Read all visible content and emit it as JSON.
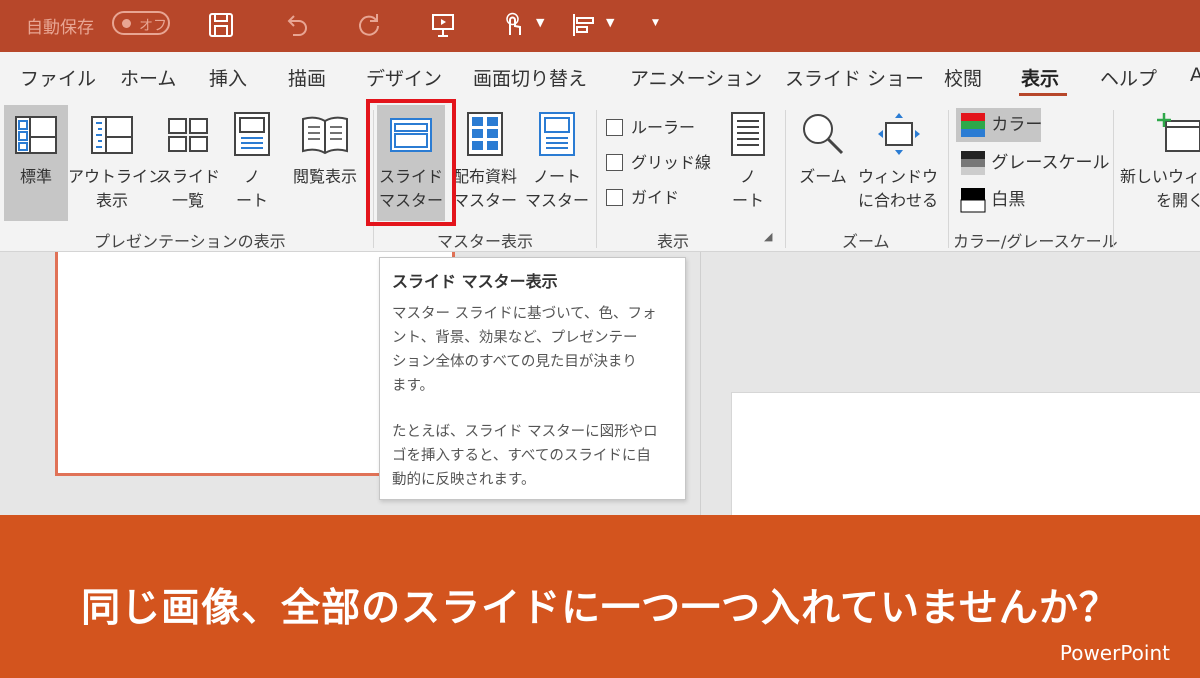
{
  "quick_access": {
    "autosave_label": "自動保存",
    "autosave_state": "オフ",
    "icons": [
      "save-icon",
      "undo-icon",
      "redo-icon",
      "present-icon",
      "touch-mode-icon",
      "align-icon",
      "customize-icon"
    ]
  },
  "tabs": [
    {
      "label": "ファイル"
    },
    {
      "label": "ホーム"
    },
    {
      "label": "挿入"
    },
    {
      "label": "描画"
    },
    {
      "label": "デザイン"
    },
    {
      "label": "画面切り替え"
    },
    {
      "label": "アニメーション"
    },
    {
      "label": "スライド ショー"
    },
    {
      "label": "校閲"
    },
    {
      "label": "表示",
      "active": true
    },
    {
      "label": "ヘルプ"
    },
    {
      "label": "A"
    }
  ],
  "ribbon": {
    "presentation_views": {
      "group_label": "プレゼンテーションの表示",
      "buttons": [
        {
          "line1": "標準",
          "line2": "",
          "selected": true
        },
        {
          "line1": "アウトライン",
          "line2": "表示"
        },
        {
          "line1": "スライド",
          "line2": "一覧"
        },
        {
          "line1": "ノ",
          "line2": "ート"
        },
        {
          "line1": "閲覧表示",
          "line2": ""
        }
      ]
    },
    "master_views": {
      "group_label": "マスター表示",
      "buttons": [
        {
          "line1": "スライド",
          "line2": "マスター",
          "selected": true
        },
        {
          "line1": "配布資料",
          "line2": "マスター"
        },
        {
          "line1": "ノート",
          "line2": "マスター"
        }
      ]
    },
    "show": {
      "group_label": "表示",
      "checkboxes": [
        "ルーラー",
        "グリッド線",
        "ガイド"
      ],
      "notes_button": {
        "line1": "ノ",
        "line2": "ート"
      }
    },
    "zoom": {
      "group_label": "ズーム",
      "buttons": [
        {
          "line1": "ズーム",
          "line2": ""
        },
        {
          "line1": "ウィンドウ",
          "line2": "に合わせる"
        }
      ]
    },
    "color": {
      "group_label": "カラー/グレースケール",
      "options": [
        {
          "label": "カラー",
          "selected": true
        },
        {
          "label": "グレースケール"
        },
        {
          "label": "白黒"
        }
      ]
    },
    "window": {
      "button": {
        "line1": "新しいウィン",
        "line2": "を開く"
      }
    }
  },
  "tooltip": {
    "title": "スライド マスター表示",
    "body1": "マスター スライドに基づいて、色、フォ\nント、背景、効果など、プレゼンテー\nション全体のすべての見た目が決まり\nます。",
    "body2": "たとえば、スライド マスターに図形やロ\nゴを挿入すると、すべてのスライドに自\n動的に反映されます。"
  },
  "banner": {
    "headline": "同じ画像、全部のスライドに一つ一つ入れていませんか？",
    "brand": "PowerPoint"
  },
  "colors": {
    "title_bar": "#b7472a",
    "banner": "#d3541e",
    "highlight": "#e3141b",
    "icon_blue": "#2b7cd3"
  }
}
